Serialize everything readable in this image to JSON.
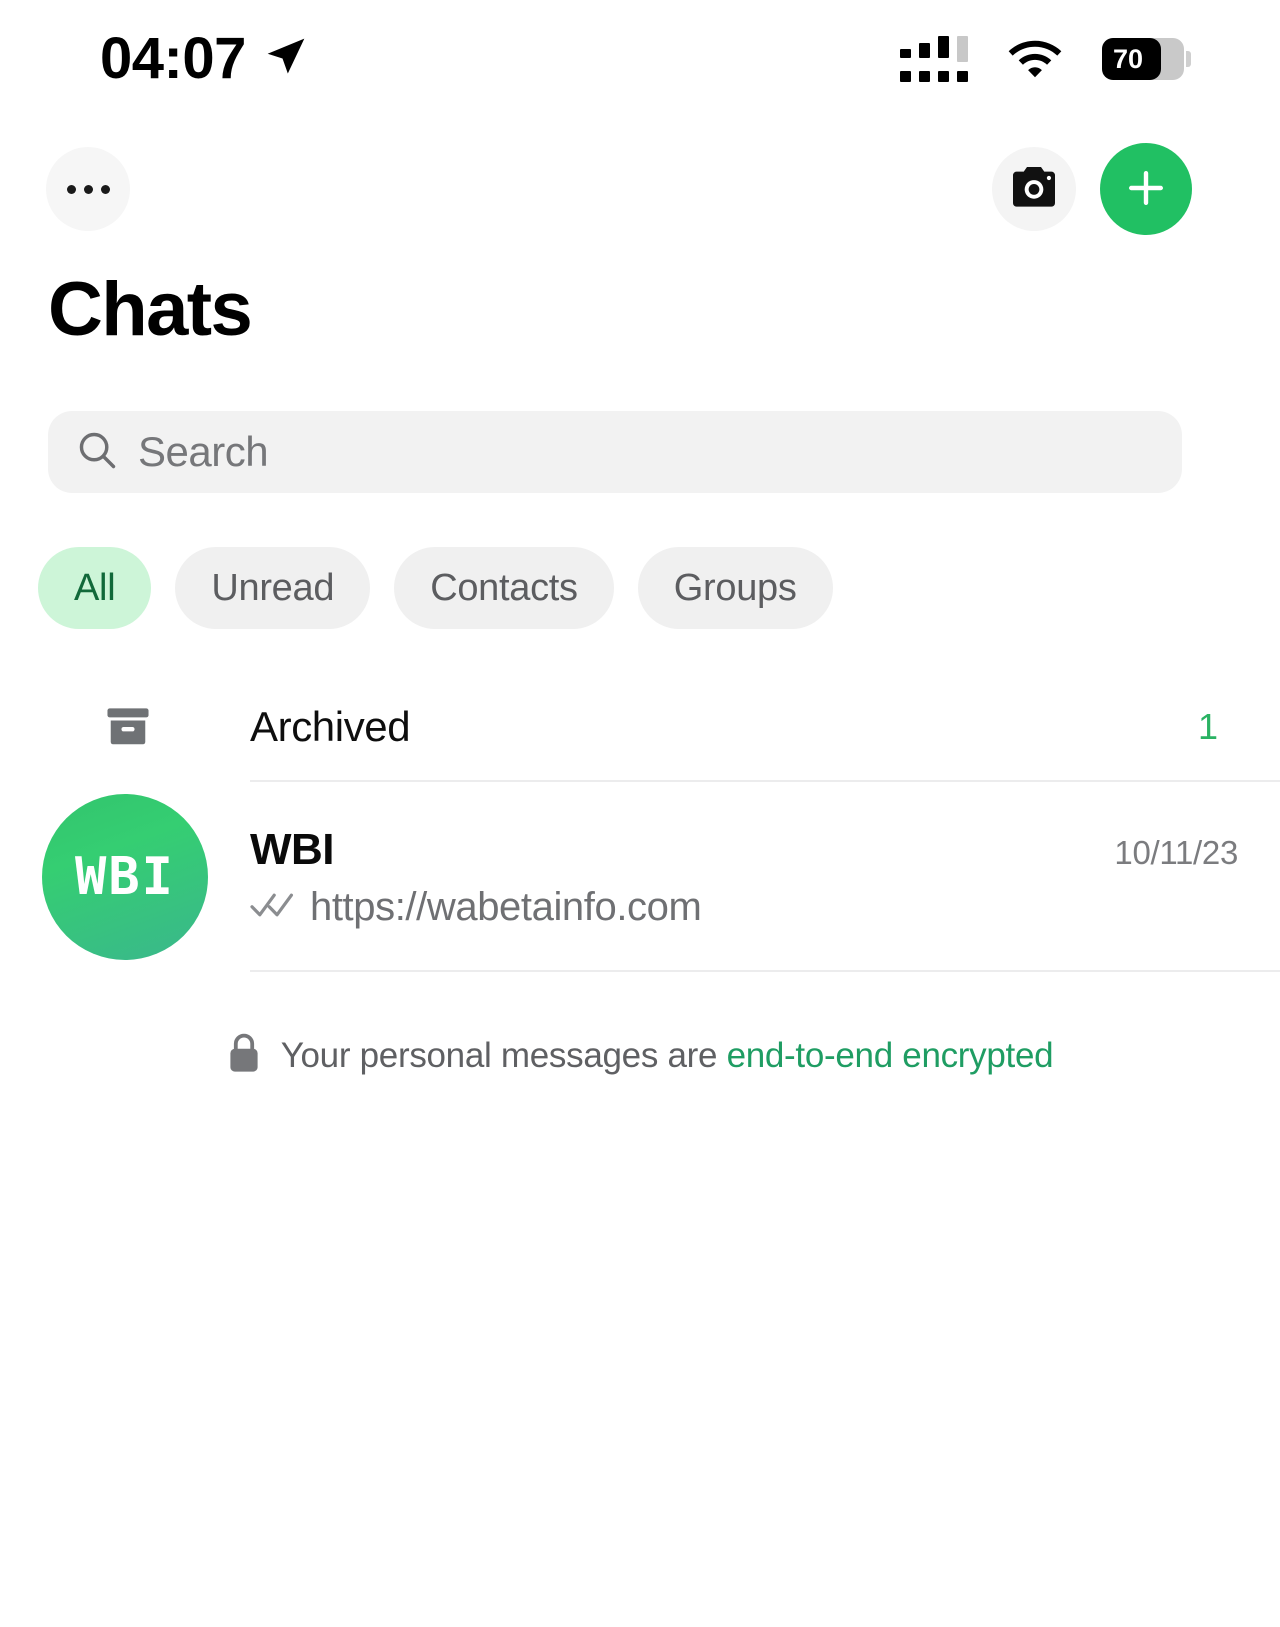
{
  "status_bar": {
    "time": "04:07",
    "location_icon": "location-arrow-icon",
    "signal_icon": "cellular-signal-icon",
    "wifi_icon": "wifi-icon",
    "battery_level": "70",
    "battery_icon": "battery-icon"
  },
  "appbar": {
    "menu_icon": "more-options-icon",
    "menu_label": "More options",
    "camera_icon": "camera-icon",
    "camera_label": "Camera",
    "new_chat_icon": "plus-icon",
    "new_chat_label": "New chat"
  },
  "header": {
    "title": "Chats"
  },
  "search": {
    "icon": "search-icon",
    "placeholder": "Search",
    "value": ""
  },
  "filters": {
    "items": [
      {
        "label": "All",
        "active": true
      },
      {
        "label": "Unread",
        "active": false
      },
      {
        "label": "Contacts",
        "active": false
      },
      {
        "label": "Groups",
        "active": false
      }
    ]
  },
  "archived": {
    "icon": "archive-box-icon",
    "label": "Archived",
    "count": "1"
  },
  "chats": [
    {
      "avatar_text": "WBI",
      "name": "WBI",
      "date": "10/11/23",
      "status_icon": "double-check-icon",
      "message": "https://wabetainfo.com"
    }
  ],
  "encryption": {
    "icon": "lock-icon",
    "text_plain": "Your personal messages are ",
    "text_highlight": "end-to-end encrypted"
  },
  "colors": {
    "brand_green": "#21c063",
    "accent_green": "#2ab263",
    "chip_active_bg": "#cdf5d8",
    "chip_active_text": "#11693a",
    "encryption_green": "#1f9d63",
    "muted_text": "#6f7073",
    "surface": "#f2f2f2"
  }
}
